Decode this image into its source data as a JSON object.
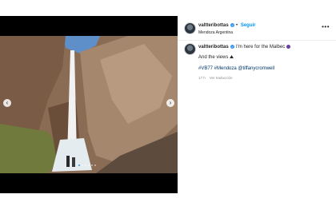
{
  "post": {
    "username": "valtteribottas",
    "follow_label": "Seguir",
    "separator": "•",
    "location": "Mendoza Argentina",
    "more_icon": "more-horizontal-icon",
    "caption_line1": "I'm here for the Malbec",
    "caption_line2": "And the views",
    "caption_tags": "#VB77 #Mendoza @tiffanycromwell",
    "time_ago": "17 h",
    "translate_label": "Ver traducción",
    "accent_color": "#0095f6",
    "verified_color": "#3897f0",
    "carousel": {
      "total": 6,
      "active": 1
    }
  }
}
